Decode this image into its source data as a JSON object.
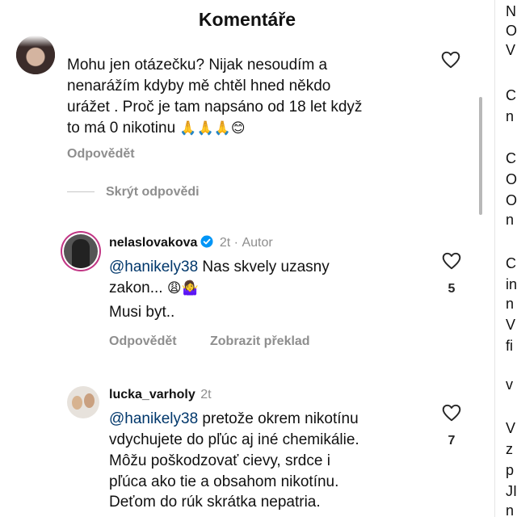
{
  "header": {
    "title": "Komentáře"
  },
  "comments": [
    {
      "lines": [
        "Mohu jen otázečku? Nijak nesoudím a",
        "nenarážím kdyby mě chtěl hned někdo",
        "urážet . Proč je tam napsáno od 18 let když",
        "to má 0 nikotinu"
      ],
      "emojis": "🙏🙏🙏😊",
      "reply_label": "Odpovědět",
      "hide_replies_label": "Skrýt odpovědi"
    }
  ],
  "replies": [
    {
      "username": "nelaslovakova",
      "verified": true,
      "time": "2t",
      "author_tag": "Autor",
      "mention": "@hanikely38",
      "line1_rest": " Nas skvely uzasny",
      "line2": "zakon...",
      "line2_emojis": "😩🤷‍♀️",
      "line3": "Musi byt..",
      "likes": "5",
      "reply_label": "Odpovědět",
      "translate_label": "Zobrazit překlad"
    },
    {
      "username": "lucka_varholy",
      "time": "2t",
      "mention": "@hanikely38",
      "line1_rest": " pretože okrem nikotínu",
      "line2": "vdychujete do pľúc aj iné chemikálie.",
      "line3": "Môžu poškodzovať cievy, srdce i",
      "line4": "pľúca ako tie a obsahom nikotínu.",
      "line5": "Deťom do rúk skrátka nepatria.",
      "likes": "7"
    }
  ],
  "side_fragments": [
    "N",
    "O",
    "V",
    "C",
    "n",
    "C",
    "O",
    "O",
    "n",
    "C",
    "in",
    "n",
    "V",
    "fi",
    "v",
    "V",
    "z",
    "p",
    "JI",
    "n"
  ],
  "colors": {
    "mention": "#00376b",
    "secondary": "#8e8e8e",
    "ring": "#c13584",
    "verified": "#0095f6"
  },
  "icons": [
    "heart-icon",
    "verified-badge-icon"
  ]
}
